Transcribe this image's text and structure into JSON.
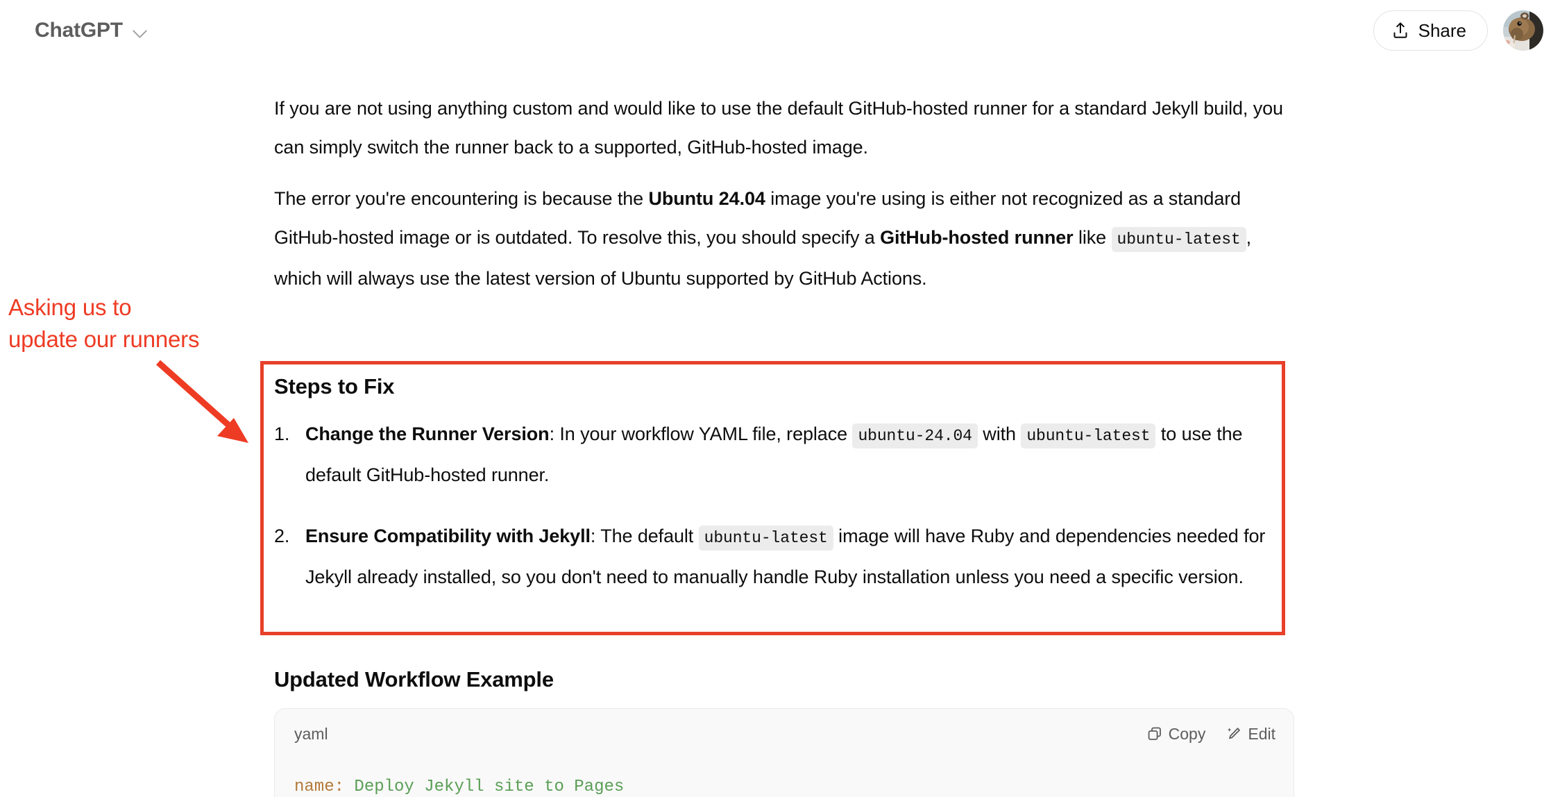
{
  "topbar": {
    "brand_title": "ChatGPT",
    "chevron_icon": "chevron-down-icon",
    "share_label": "Share",
    "share_icon": "upload-icon",
    "avatar_alt": "user-avatar"
  },
  "accent_colors": {
    "annotation_red": "#ee3b24",
    "box_border_red": "#e8402a",
    "code_key": "#b5793a",
    "code_string": "#5a9e55",
    "inline_code_bg": "#ececec"
  },
  "annotation": {
    "line1": "Asking us to",
    "line2": "update our runners"
  },
  "main": {
    "paragraph1": {
      "text": "If you are not using anything custom and would like to use the default GitHub-hosted runner for a standard Jekyll build, you can simply switch the runner back to a supported, GitHub-hosted image."
    },
    "paragraph2": {
      "seg1": "The error you're encountering is because the ",
      "bold1": "Ubuntu 24.04",
      "seg2": " image you're using is either not recognized as a standard GitHub-hosted image or is outdated. To resolve this, you should specify a ",
      "bold2": "GitHub-hosted runner",
      "seg3": " like ",
      "code1": "ubuntu-latest",
      "seg4": ", which will always use the latest version of Ubuntu supported by GitHub Actions."
    },
    "steps_section": {
      "heading": "Steps to Fix",
      "items": [
        {
          "number": "1.",
          "bold": "Change the Runner Version",
          "seg1": ": In your workflow YAML file, replace ",
          "code1": "ubuntu-24.04",
          "seg2": " with ",
          "code2": "ubuntu-latest",
          "seg3": " to use the default GitHub-hosted runner."
        },
        {
          "number": "2.",
          "bold": "Ensure Compatibility with Jekyll",
          "seg1": ": The default ",
          "code1": "ubuntu-latest",
          "seg2": " image will have Ruby and dependencies needed for Jekyll already installed, so you don't need to manually handle Ruby installation unless you need a specific version.",
          "code2": "",
          "seg3": ""
        }
      ]
    },
    "workflow_section": {
      "heading": "Updated Workflow Example",
      "code_block": {
        "language": "yaml",
        "copy_label": "Copy",
        "copy_icon": "copy-icon",
        "edit_label": "Edit",
        "edit_icon": "edit-pencil-icon",
        "line1_key": "name:",
        "line1_value": " Deploy Jekyll site to Pages"
      }
    }
  }
}
